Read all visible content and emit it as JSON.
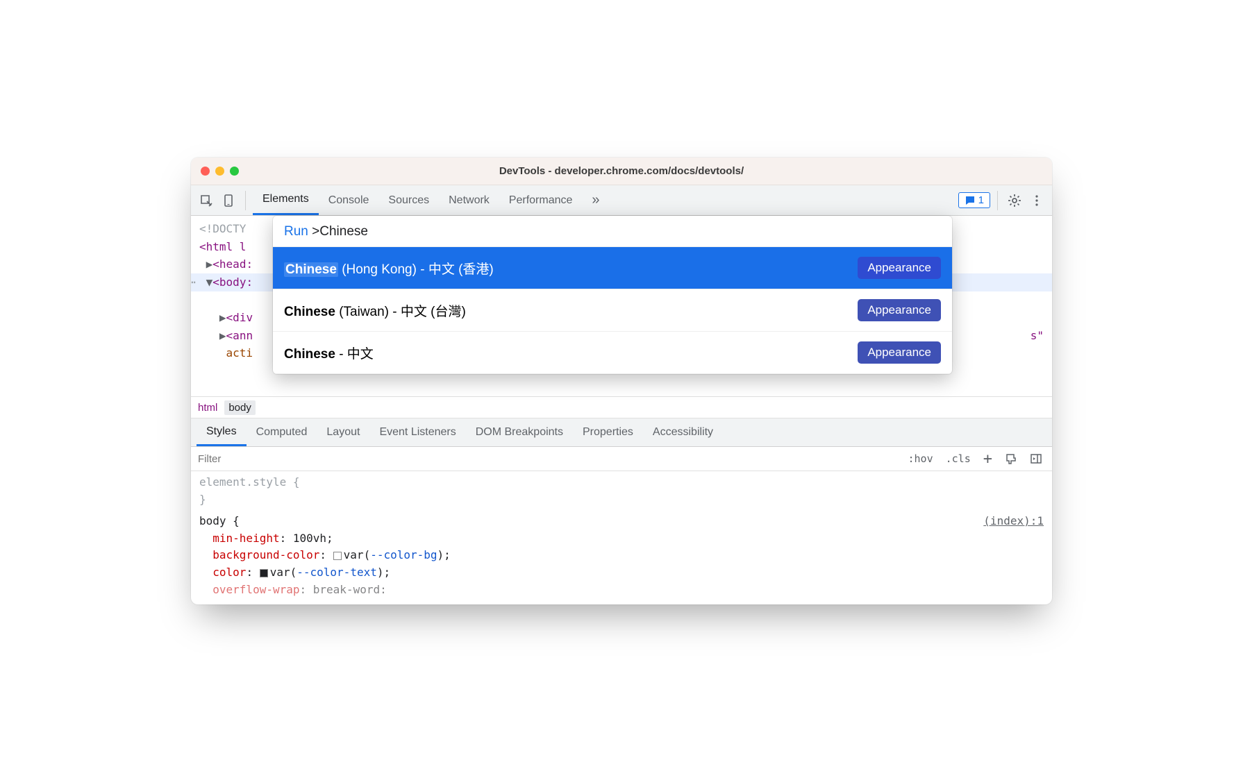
{
  "window": {
    "title": "DevTools - developer.chrome.com/docs/devtools/"
  },
  "toolbar": {
    "tabs": [
      "Elements",
      "Console",
      "Sources",
      "Network",
      "Performance"
    ],
    "active_tab": "Elements",
    "more_tabs_glyph": "»",
    "issues_count": "1"
  },
  "dom": {
    "doctype": "<!DOCTY",
    "html_open": "<html l",
    "head": "<head:",
    "body": "<body:",
    "div": "<div",
    "ann": "<ann",
    "acti": "acti",
    "suffix_s": "s\""
  },
  "breadcrumb": {
    "items": [
      "html",
      "body"
    ]
  },
  "styles_tabs": [
    "Styles",
    "Computed",
    "Layout",
    "Event Listeners",
    "DOM Breakpoints",
    "Properties",
    "Accessibility"
  ],
  "styles_active": "Styles",
  "filter": {
    "placeholder": "Filter",
    "hov": ":hov",
    "cls": ".cls"
  },
  "css": {
    "element_style": "element.style {",
    "close": "}",
    "body_selector": "body {",
    "source": "(index):1",
    "rules": [
      {
        "prop": "min-height",
        "val": "100vh",
        "var": null,
        "swatch": null
      },
      {
        "prop": "background-color",
        "val": "var",
        "var": "--color-bg",
        "swatch": "light"
      },
      {
        "prop": "color",
        "val": "var",
        "var": "--color-text",
        "swatch": "dark"
      },
      {
        "prop": "overflow-wrap",
        "val": "break-word",
        "var": null,
        "swatch": null,
        "cut": true
      }
    ]
  },
  "command_menu": {
    "run_label": "Run",
    "prefix": ">",
    "query": "Chinese",
    "items": [
      {
        "match": "Chinese",
        "rest": " (Hong Kong) - 中文 (香港)",
        "badge": "Appearance",
        "selected": true
      },
      {
        "match": "Chinese",
        "rest": " (Taiwan) - 中文 (台灣)",
        "badge": "Appearance",
        "selected": false
      },
      {
        "match": "Chinese",
        "rest": " - 中文",
        "badge": "Appearance",
        "selected": false
      }
    ]
  }
}
